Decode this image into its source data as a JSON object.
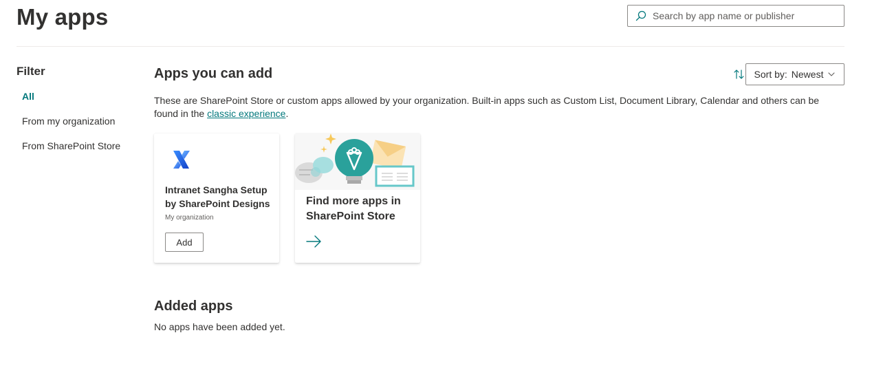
{
  "header": {
    "title": "My apps",
    "search_placeholder": "Search by app name or publisher"
  },
  "filter": {
    "title": "Filter",
    "items": [
      {
        "label": "All",
        "active": true
      },
      {
        "label": "From my organization",
        "active": false
      },
      {
        "label": "From SharePoint Store",
        "active": false
      }
    ]
  },
  "apps_section": {
    "title": "Apps you can add",
    "sort_label": "Sort by:",
    "sort_value": "Newest",
    "description_text": "These are SharePoint Store or custom apps allowed by your organization. Built-in apps such as Custom List, Document Library, Calendar and others can be found in the ",
    "description_link": "classic experience",
    "description_end": ".",
    "cards": [
      {
        "name": "Intranet Sangha Setup by SharePoint Designs",
        "publisher": "My organization",
        "button_label": "Add",
        "icon": "sharepoint-designs-logo-icon"
      }
    ],
    "store_card": {
      "label": "Find more apps in SharePoint Store",
      "icon": "arrow-right-icon"
    }
  },
  "added_section": {
    "title": "Added apps",
    "empty_text": "No apps have been added yet."
  },
  "colors": {
    "accent": "#03787c",
    "text": "#323130",
    "border": "#8a8886"
  }
}
